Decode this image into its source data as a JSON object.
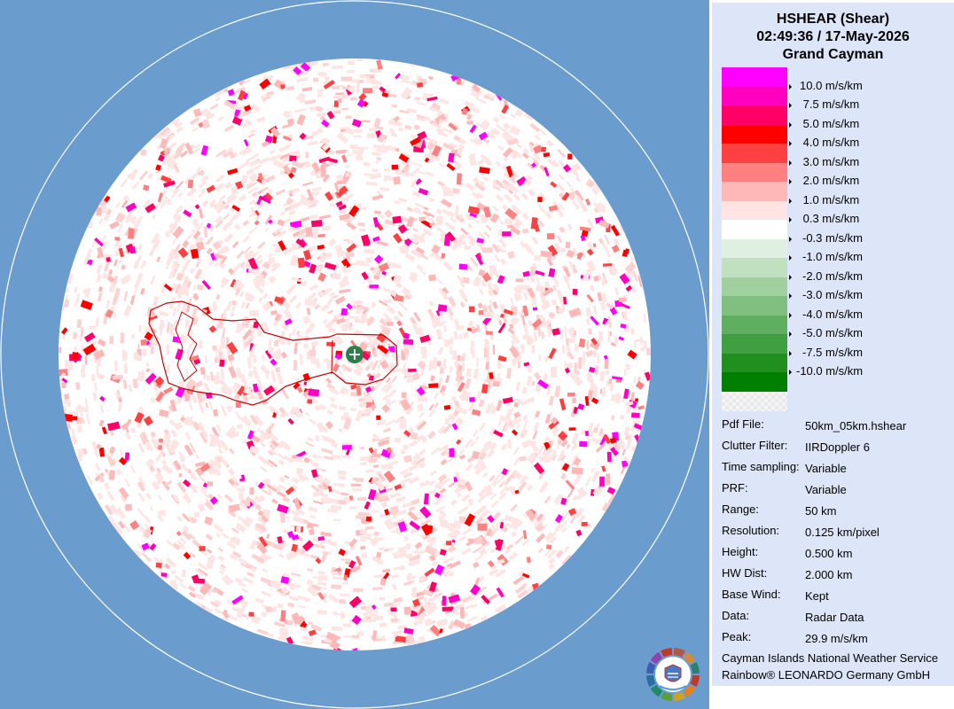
{
  "panel": {
    "title_product": "HSHEAR (Shear)",
    "title_datetime": "02:49:36 / 17-May-2026",
    "title_site": "Grand Cayman"
  },
  "legend": {
    "swatches": [
      {
        "color": "#ff00ff"
      },
      {
        "color": "#ff00c0"
      },
      {
        "color": "#ff0066"
      },
      {
        "color": "#ff0000"
      },
      {
        "color": "#ff4040"
      },
      {
        "color": "#ff8080"
      },
      {
        "color": "#ffb8b8"
      },
      {
        "color": "#ffe4e4"
      },
      {
        "color": "#ffffff"
      },
      {
        "color": "#e0f0e0"
      },
      {
        "color": "#c0e0c0"
      },
      {
        "color": "#a0d0a0"
      },
      {
        "color": "#80bf80"
      },
      {
        "color": "#60af60"
      },
      {
        "color": "#409f40"
      },
      {
        "color": "#208f20"
      },
      {
        "color": "#007f00"
      }
    ],
    "labels": [
      "10.0 m/s/km",
      " 7.5 m/s/km",
      " 5.0 m/s/km",
      " 4.0 m/s/km",
      " 3.0 m/s/km",
      " 2.0 m/s/km",
      " 1.0 m/s/km",
      " 0.3 m/s/km",
      "-0.3 m/s/km",
      "-1.0 m/s/km",
      "-2.0 m/s/km",
      "-3.0 m/s/km",
      "-4.0 m/s/km",
      "-5.0 m/s/km",
      "-7.5 m/s/km",
      "-10.0 m/s/km"
    ]
  },
  "info": [
    {
      "label": "Pdf File:",
      "value": "50km_05km.hshear"
    },
    {
      "label": "Clutter Filter:",
      "value": "IIRDoppler 6"
    },
    {
      "label": "Time sampling:",
      "value": "Variable"
    },
    {
      "label": "PRF:",
      "value": "Variable"
    },
    {
      "label": "Range:",
      "value": "50 km"
    },
    {
      "label": "Resolution:",
      "value": "0.125 km/pixel"
    },
    {
      "label": "Height:",
      "value": "0.500 km"
    },
    {
      "label": "HW Dist:",
      "value": "2.000 km"
    },
    {
      "label": "Base Wind:",
      "value": "Kept"
    },
    {
      "label": "Data:",
      "value": "Radar Data"
    },
    {
      "label": "Peak:",
      "value": "29.9 m/s/km"
    }
  ],
  "footer": {
    "line1": "Cayman Islands National Weather Service",
    "line2": "Rainbow® LEONARDO Germany GmbH"
  },
  "colors": {
    "background_sea": "#6a9cce",
    "panel_bg": "#dde6f8",
    "radar_site_marker": "#2e7d4a",
    "coastline": "#cc0000"
  },
  "icons": {
    "radar_site": "radar-site-plus-icon",
    "logo": "cayman-weather-service-logo-icon"
  }
}
